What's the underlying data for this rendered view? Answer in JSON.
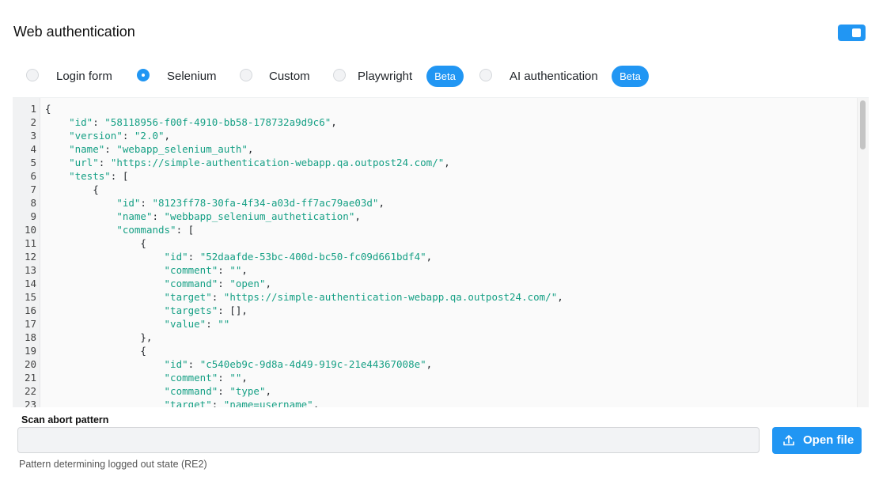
{
  "section": {
    "title": "Web authentication",
    "enabled": true
  },
  "auth_options": [
    {
      "label": "Login form",
      "selected": false,
      "badge": ""
    },
    {
      "label": "Selenium",
      "selected": true,
      "badge": ""
    },
    {
      "label": "Custom",
      "selected": false,
      "badge": ""
    },
    {
      "label": "Playwright",
      "selected": false,
      "badge": "Beta"
    },
    {
      "label": "AI authentication",
      "selected": false,
      "badge": "Beta"
    }
  ],
  "editor": {
    "lines": [
      {
        "n": "1",
        "text": "{"
      },
      {
        "n": "2",
        "text": "    \"id\": \"58118956-f00f-4910-bb58-178732a9d9c6\","
      },
      {
        "n": "3",
        "text": "    \"version\": \"2.0\","
      },
      {
        "n": "4",
        "text": "    \"name\": \"webapp_selenium_auth\","
      },
      {
        "n": "5",
        "text": "    \"url\": \"https://simple-authentication-webapp.qa.outpost24.com/\","
      },
      {
        "n": "6",
        "text": "    \"tests\": ["
      },
      {
        "n": "7",
        "text": "        {"
      },
      {
        "n": "8",
        "text": "            \"id\": \"8123ff78-30fa-4f34-a03d-ff7ac79ae03d\","
      },
      {
        "n": "9",
        "text": "            \"name\": \"webbapp_selenium_authetication\","
      },
      {
        "n": "10",
        "text": "            \"commands\": ["
      },
      {
        "n": "11",
        "text": "                {"
      },
      {
        "n": "12",
        "text": "                    \"id\": \"52daafde-53bc-400d-bc50-fc09d661bdf4\","
      },
      {
        "n": "13",
        "text": "                    \"comment\": \"\","
      },
      {
        "n": "14",
        "text": "                    \"command\": \"open\","
      },
      {
        "n": "15",
        "text": "                    \"target\": \"https://simple-authentication-webapp.qa.outpost24.com/\","
      },
      {
        "n": "16",
        "text": "                    \"targets\": [],"
      },
      {
        "n": "17",
        "text": "                    \"value\": \"\""
      },
      {
        "n": "18",
        "text": "                },"
      },
      {
        "n": "19",
        "text": "                {"
      },
      {
        "n": "20",
        "text": "                    \"id\": \"c540eb9c-9d8a-4d49-919c-21e44367008e\","
      },
      {
        "n": "21",
        "text": "                    \"comment\": \"\","
      },
      {
        "n": "22",
        "text": "                    \"command\": \"type\","
      },
      {
        "n": "23",
        "text": "                    \"target\": \"name=username\","
      }
    ]
  },
  "scan_abort": {
    "label": "Scan abort pattern",
    "value": "",
    "placeholder": "",
    "helper": "Pattern determining logged out state (RE2)"
  },
  "open_file": {
    "label": "Open file",
    "icon": "upload-icon"
  },
  "colors": {
    "accent": "#2196f3",
    "json_token": "#16a085"
  }
}
